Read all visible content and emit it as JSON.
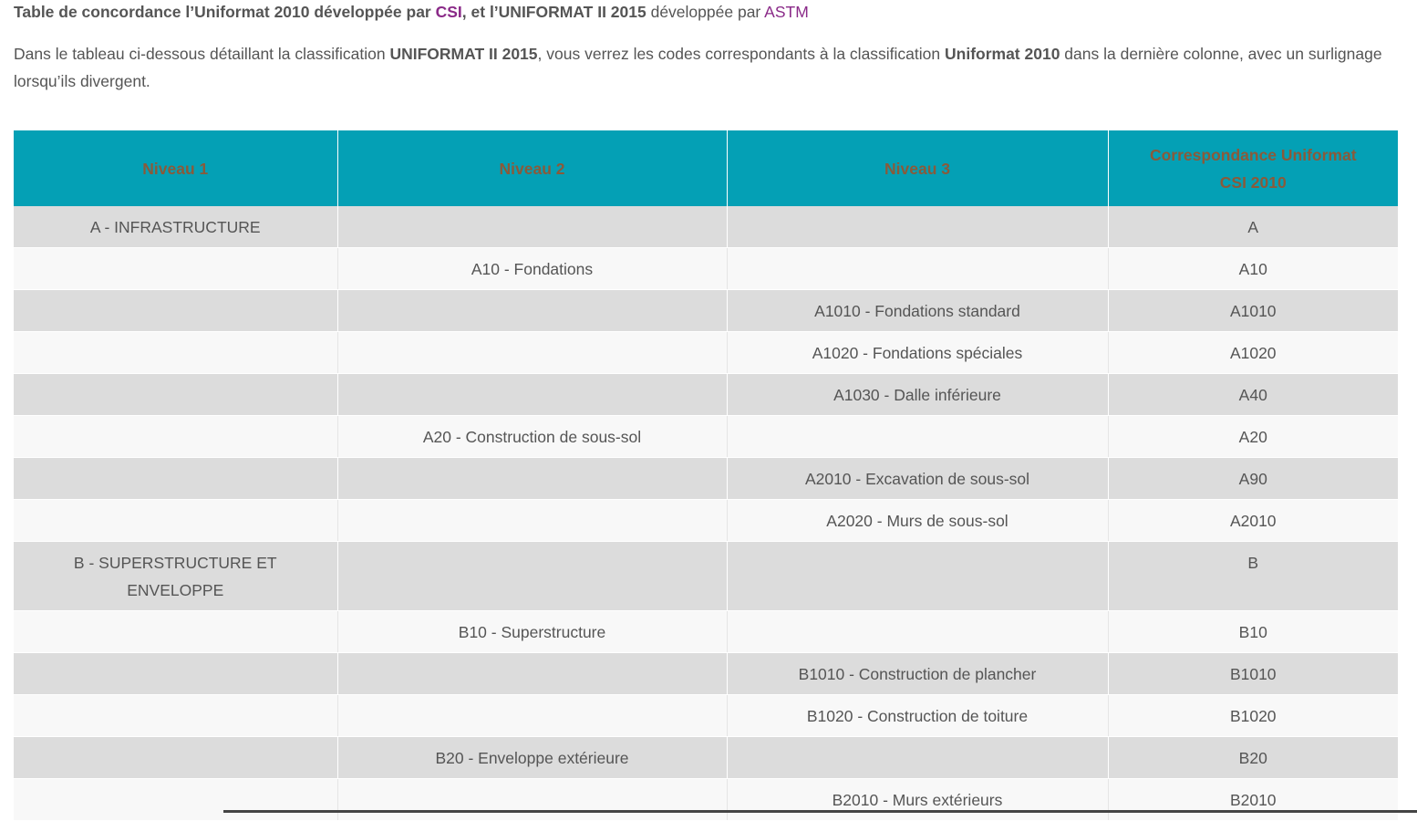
{
  "title": {
    "part1": "Table de concordance  l’Uniformat 2010 développée par ",
    "link1": "CSI",
    "part2": ", et l’UNIFORMAT II 2015",
    "part3": " développée par ",
    "link2": "ASTM"
  },
  "intro": {
    "t1": "Dans le tableau ci-dessous détaillant la classification ",
    "b1": "UNIFORMAT II 2015",
    "t2": ", vous verrez les codes correspondants à la classification ",
    "b2": "Uniformat 2010",
    "t3": " dans la dernière colonne, avec un surlignage lorsqu’ils divergent."
  },
  "table": {
    "headers": [
      "Niveau 1",
      "Niveau 2",
      "Niveau 3",
      "Correspondance Uniformat CSI 2010"
    ],
    "rows": [
      [
        "A - INFRASTRUCTURE",
        "",
        "",
        "A"
      ],
      [
        "",
        "A10 - Fondations",
        "",
        "A10"
      ],
      [
        "",
        "",
        "A1010 - Fondations standard",
        "A1010"
      ],
      [
        "",
        "",
        "A1020 - Fondations spéciales",
        "A1020"
      ],
      [
        "",
        "",
        "A1030 - Dalle inférieure",
        "A40"
      ],
      [
        "",
        "A20 - Construction de sous-sol",
        "",
        "A20"
      ],
      [
        "",
        "",
        "A2010 - Excavation de sous-sol",
        "A90"
      ],
      [
        "",
        "",
        "A2020 - Murs de sous-sol",
        "A2010"
      ],
      [
        "B - SUPERSTRUCTURE ET ENVELOPPE",
        "",
        "",
        "B"
      ],
      [
        "",
        "B10 - Superstructure",
        "",
        "B10"
      ],
      [
        "",
        "",
        "B1010 - Construction de plancher",
        "B1010"
      ],
      [
        "",
        "",
        "B1020 - Construction de toiture",
        "B1020"
      ],
      [
        "",
        "B20 - Enveloppe extérieure",
        "",
        "B20"
      ],
      [
        "",
        "",
        "B2010 - Murs extérieurs",
        "B2010"
      ]
    ]
  },
  "colors": {
    "header_bg": "#04a0b5",
    "header_text": "#8a5a3a",
    "row_odd": "#dcdcdc",
    "row_even": "#f8f8f8",
    "link": "#8a2a88"
  }
}
